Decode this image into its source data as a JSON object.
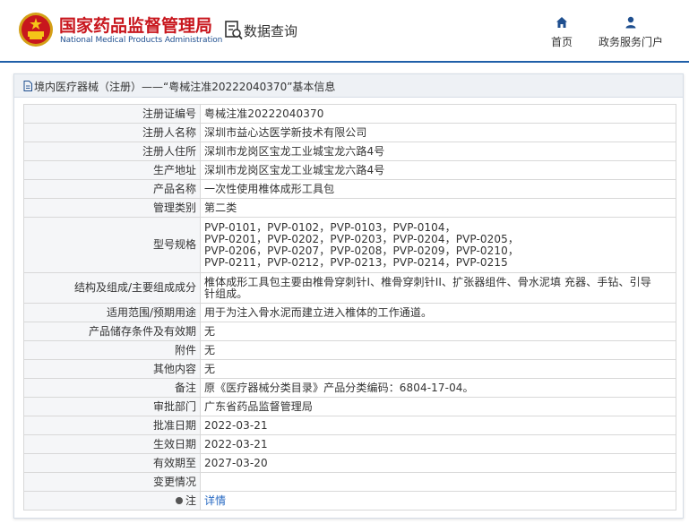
{
  "header": {
    "site_title": "国家药品监督管理局",
    "site_subtitle": "National Medical Products Administration",
    "query_label": "数据查询",
    "nav": [
      {
        "label": "首页",
        "icon": "home-icon"
      },
      {
        "label": "政务服务门户",
        "icon": "user-icon"
      }
    ],
    "brand_color": "#c8161d",
    "accent_color": "#1f5fa8"
  },
  "panel": {
    "title": "境内医疗器械（注册）——“粤械注准20222040370”基本信息",
    "rows": [
      {
        "label": "注册证编号",
        "value": "粤械注准20222040370"
      },
      {
        "label": "注册人名称",
        "value": "深圳市益心达医学新技术有限公司"
      },
      {
        "label": "注册人住所",
        "value": "深圳市龙岗区宝龙工业城宝龙六路4号"
      },
      {
        "label": "生产地址",
        "value": "深圳市龙岗区宝龙工业城宝龙六路4号"
      },
      {
        "label": "产品名称",
        "value": "一次性使用椎体成形工具包"
      },
      {
        "label": "管理类别",
        "value": "第二类"
      },
      {
        "label": "型号规格",
        "lines": [
          "PVP-0101，PVP-0102，PVP-0103，PVP-0104，",
          "PVP-0201，PVP-0202，PVP-0203，PVP-0204，PVP-0205，",
          "PVP-0206，PVP-0207，PVP-0208，PVP-0209，PVP-0210，",
          "PVP-0211，PVP-0212，PVP-0213，PVP-0214，PVP-0215"
        ]
      },
      {
        "label": "结构及组成/主要组成成分",
        "lines": [
          "椎体成形工具包主要由椎骨穿刺针I、椎骨穿刺针II、扩张器组件、骨水泥填 充器、手钻、引导",
          "针组成。"
        ]
      },
      {
        "label": "适用范围/预期用途",
        "value": "用于为注入骨水泥而建立进入椎体的工作通道。"
      },
      {
        "label": "产品储存条件及有效期",
        "value": "无"
      },
      {
        "label": "附件",
        "value": "无"
      },
      {
        "label": "其他内容",
        "value": "无"
      },
      {
        "label": "备注",
        "value": "原《医疗器械分类目录》产品分类编码：6804-17-04。"
      },
      {
        "label": "审批部门",
        "value": "广东省药品监督管理局"
      },
      {
        "label": "批准日期",
        "value": "2022-03-21"
      },
      {
        "label": "生效日期",
        "value": "2022-03-21"
      },
      {
        "label": "有效期至",
        "value": "2027-03-20"
      },
      {
        "label": "变更情况",
        "value": ""
      },
      {
        "label": "注",
        "value": "详情",
        "icon": "pin-icon"
      }
    ]
  }
}
